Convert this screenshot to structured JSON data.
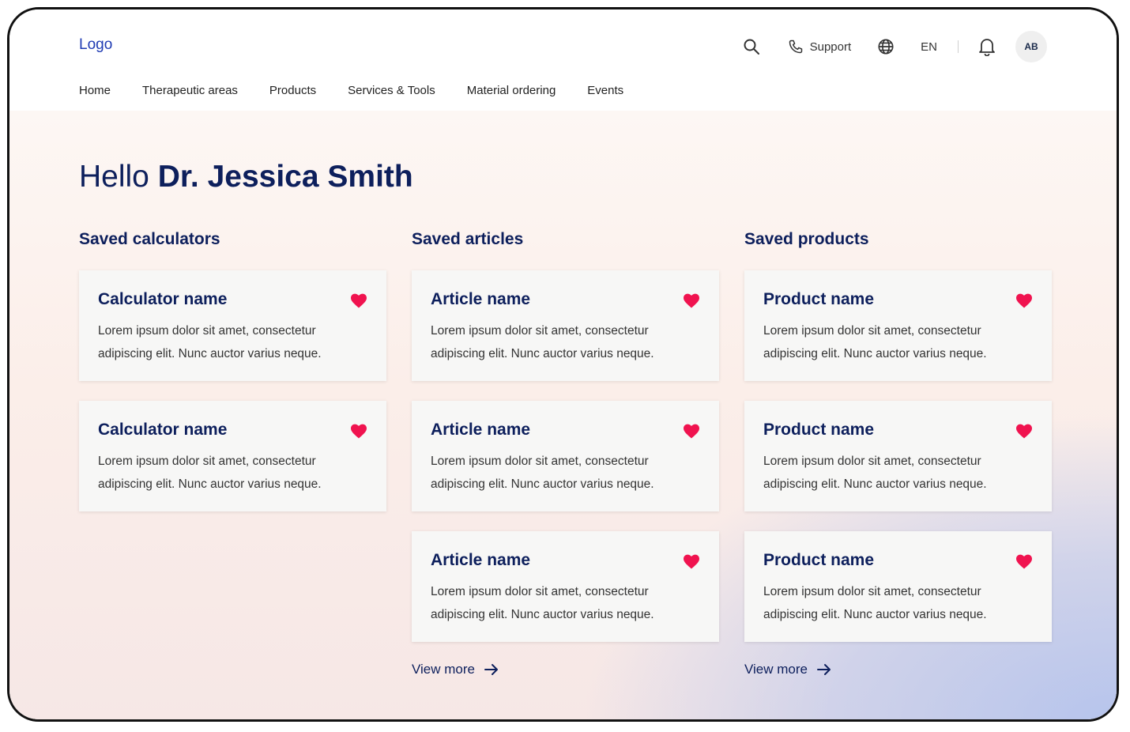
{
  "header": {
    "logo": "Logo",
    "support_label": "Support",
    "language": "EN",
    "avatar_initials": "AB",
    "nav": [
      "Home",
      "Therapeutic areas",
      "Products",
      "Services & Tools",
      "Material ordering",
      "Events"
    ]
  },
  "greeting": {
    "hello": "Hello",
    "name": "Dr. Jessica Smith"
  },
  "sections": {
    "calculators": {
      "title": "Saved calculators",
      "cards": [
        {
          "title": "Calculator name",
          "desc": "Lorem ipsum dolor sit amet, consectetur adipiscing elit. Nunc auctor varius neque."
        },
        {
          "title": "Calculator name",
          "desc": "Lorem ipsum dolor sit amet, consectetur adipiscing elit. Nunc auctor varius neque."
        }
      ]
    },
    "articles": {
      "title": "Saved articles",
      "cards": [
        {
          "title": "Article name",
          "desc": "Lorem ipsum dolor sit amet, consectetur adipiscing elit. Nunc auctor varius neque."
        },
        {
          "title": "Article name",
          "desc": "Lorem ipsum dolor sit amet, consectetur adipiscing elit. Nunc auctor varius neque."
        },
        {
          "title": "Article name",
          "desc": "Lorem ipsum dolor sit amet, consectetur adipiscing elit. Nunc auctor varius neque."
        }
      ],
      "view_more": "View more"
    },
    "products": {
      "title": "Saved products",
      "cards": [
        {
          "title": "Product name",
          "desc": "Lorem ipsum dolor sit amet, consectetur adipiscing elit. Nunc auctor varius neque."
        },
        {
          "title": "Product name",
          "desc": "Lorem ipsum dolor sit amet, consectetur adipiscing elit. Nunc auctor varius neque."
        },
        {
          "title": "Product name",
          "desc": "Lorem ipsum dolor sit amet, consectetur adipiscing elit. Nunc auctor varius neque."
        }
      ],
      "view_more": "View more"
    }
  },
  "icons": {
    "search": "search-icon",
    "phone": "phone-icon",
    "globe": "globe-icon",
    "bell": "bell-icon",
    "heart": "heart-icon",
    "arrow": "arrow-right-icon"
  },
  "colors": {
    "navy": "#0d1f5c",
    "logo": "#1f3bb3",
    "heart": "#f0134f",
    "card": "#f7f7f6"
  }
}
